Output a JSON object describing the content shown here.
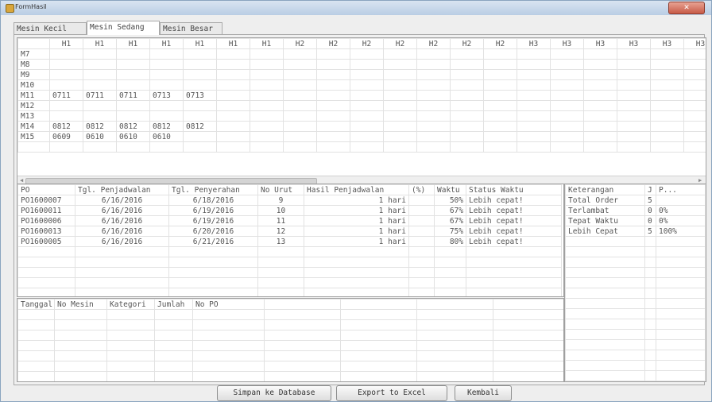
{
  "window": {
    "title": "FormHasil",
    "close_glyph": "✕"
  },
  "tabs": [
    {
      "label": "Mesin Kecil",
      "active": false
    },
    {
      "label": "Mesin Sedang",
      "active": true
    },
    {
      "label": "Mesin Besar",
      "active": false
    }
  ],
  "schedule_grid": {
    "columns": [
      "",
      "H1",
      "H1",
      "H1",
      "H1",
      "H1",
      "H1",
      "H1",
      "H2",
      "H2",
      "H2",
      "H2",
      "H2",
      "H2",
      "H2",
      "H3",
      "H3",
      "H3",
      "H3",
      "H3",
      "H3"
    ],
    "rows": [
      {
        "machine": "M7",
        "cells": []
      },
      {
        "machine": "M8",
        "cells": []
      },
      {
        "machine": "M9",
        "cells": []
      },
      {
        "machine": "M10",
        "cells": []
      },
      {
        "machine": "M11",
        "cells": [
          "0711",
          "0711",
          "0711",
          "0713",
          "0713"
        ]
      },
      {
        "machine": "M12",
        "cells": []
      },
      {
        "machine": "M13",
        "cells": []
      },
      {
        "machine": "M14",
        "cells": [
          "0812",
          "0812",
          "0812",
          "0812",
          "0812"
        ]
      },
      {
        "machine": "M15",
        "cells": [
          "0609",
          "0610",
          "0610",
          "0610"
        ]
      }
    ]
  },
  "orders_grid": {
    "columns": [
      "PO",
      "Tgl. Penjadwalan",
      "Tgl. Penyerahan",
      "No Urut",
      "Hasil Penjadwalan",
      "(%)",
      "Waktu",
      "Status Waktu"
    ],
    "rows": [
      [
        "PO1600007",
        "6/16/2016",
        "6/18/2016",
        "9",
        "1 hari",
        "50%",
        "Lebih cepat!"
      ],
      [
        "PO1600011",
        "6/16/2016",
        "6/19/2016",
        "10",
        "1 hari",
        "67%",
        "Lebih cepat!"
      ],
      [
        "PO1600006",
        "6/16/2016",
        "6/19/2016",
        "11",
        "1 hari",
        "67%",
        "Lebih cepat!"
      ],
      [
        "PO1600013",
        "6/16/2016",
        "6/20/2016",
        "12",
        "1 hari",
        "75%",
        "Lebih cepat!"
      ],
      [
        "PO1600005",
        "6/16/2016",
        "6/21/2016",
        "13",
        "1 hari",
        "80%",
        "Lebih cepat!"
      ]
    ]
  },
  "summary_grid": {
    "columns": [
      "Keterangan",
      "J",
      "P..."
    ],
    "rows": [
      [
        "Total Order",
        "5",
        ""
      ],
      [
        "Terlambat",
        "0",
        "0%"
      ],
      [
        "Tepat Waktu",
        "0",
        "0%"
      ],
      [
        "Lebih Cepat",
        "5",
        "100%"
      ]
    ]
  },
  "machine_grid": {
    "columns": [
      "Tanggal",
      "No Mesin",
      "Kategori",
      "Jumlah",
      "No PO"
    ]
  },
  "buttons": {
    "save": "Simpan ke Database",
    "export": "Export to Excel",
    "back": "Kembali"
  }
}
